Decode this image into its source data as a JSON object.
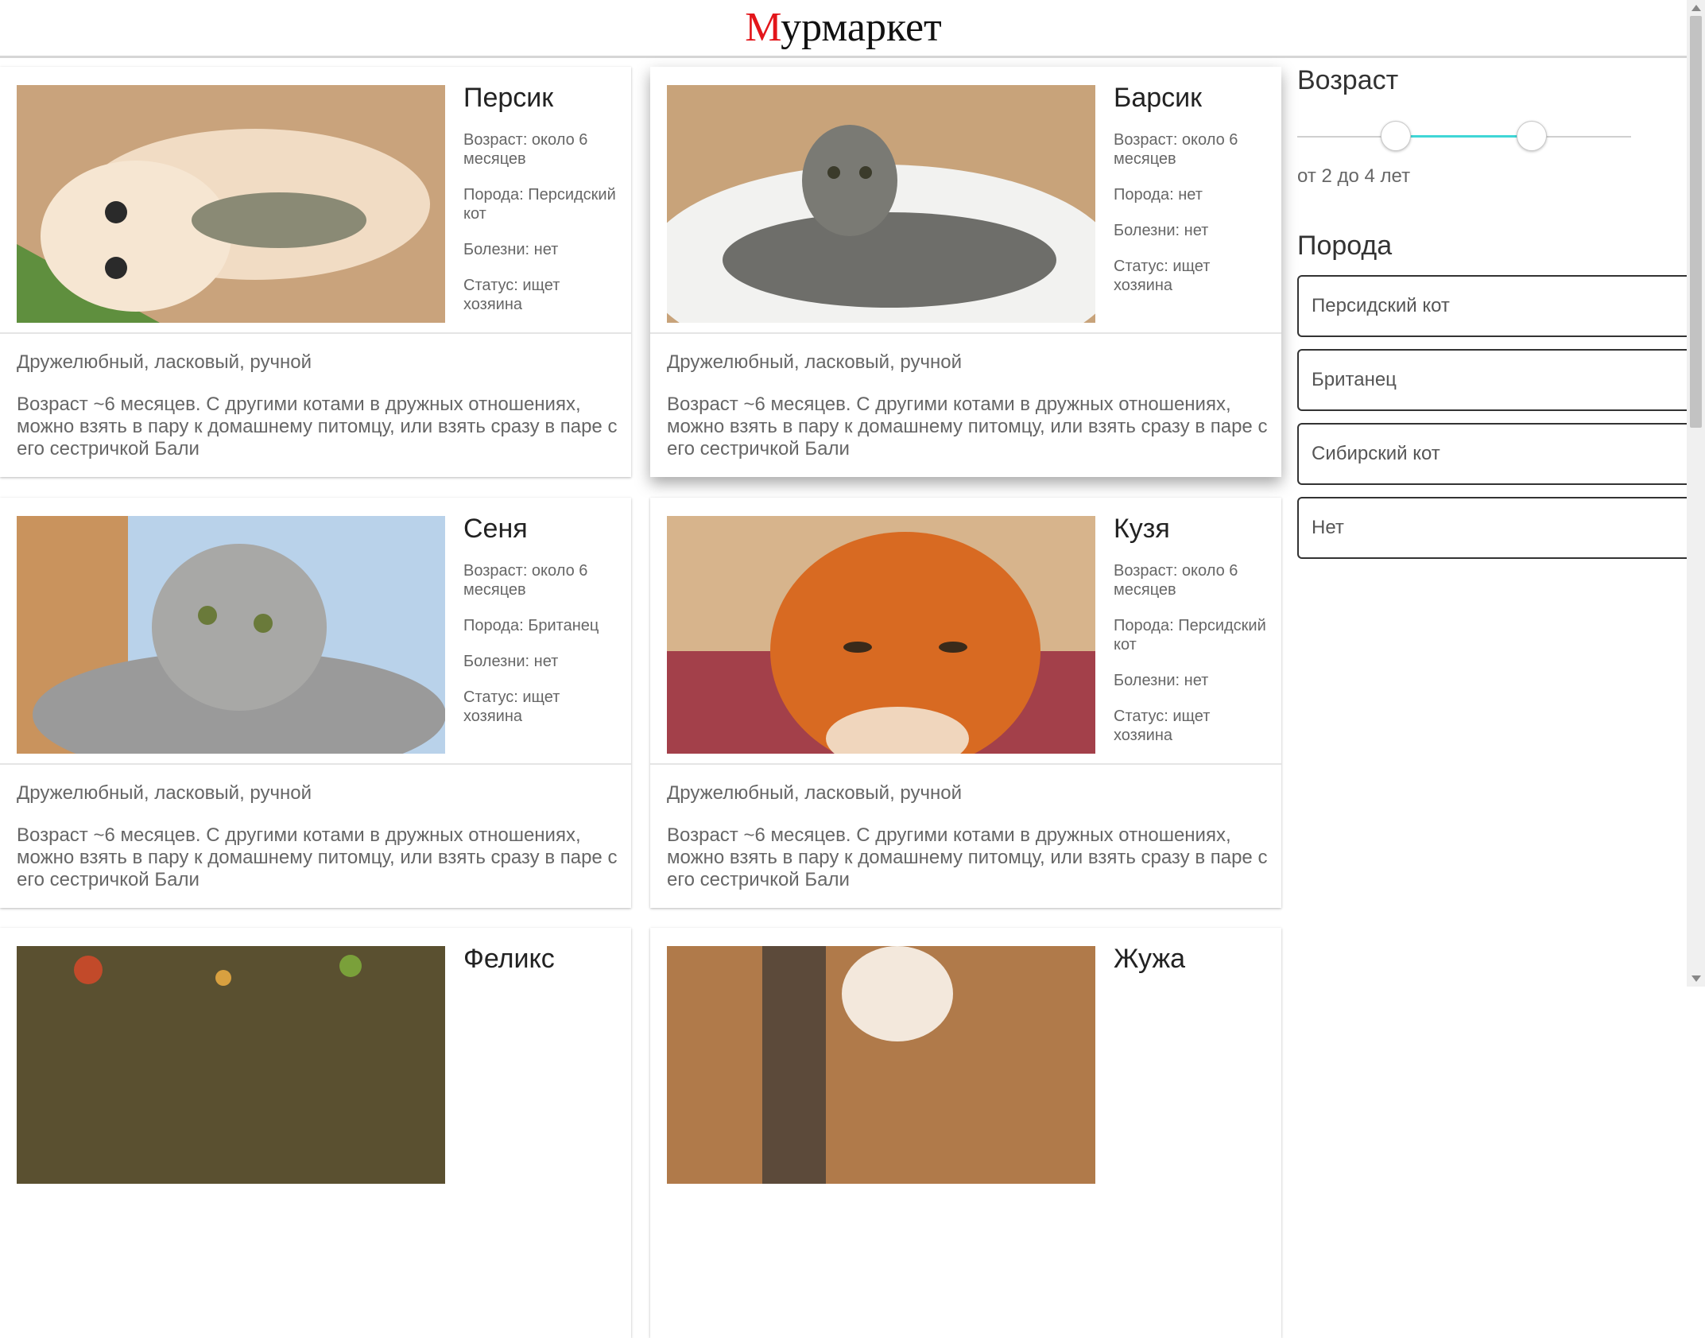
{
  "brand": {
    "first_letter": "М",
    "rest": "урмаркет"
  },
  "labels": {
    "age": "Возраст: около 6 месяцев",
    "tagline": "Дружелюбный, ласковый, ручной",
    "desc": "Возраст ~6 месяцев. С другими котами в дружных отношениях, можно взять в пару к домашнему питомцу, или взять сразу в паре с его сестричкой Бали"
  },
  "cats": [
    {
      "name": "Персик",
      "age": "Возраст: около 6 месяцев",
      "breed": "Порода: Персидский кот",
      "disease": "Болезни: нет",
      "status": "Статус: ищет хозяина",
      "tagline": "Дружелюбный, ласковый, ручной",
      "desc": "Возраст ~6 месяцев. С другими котами в дружных отношениях, можно взять в пару к домашнему питомцу, или взять сразу в паре с его сестричкой Бали"
    },
    {
      "name": "Барсик",
      "age": "Возраст: около 6 месяцев",
      "breed": "Порода: нет",
      "disease": "Болезни: нет",
      "status": "Статус: ищет хозяина",
      "tagline": "Дружелюбный, ласковый, ручной",
      "desc": "Возраст ~6 месяцев. С другими котами в дружных отношениях, можно взять в пару к домашнему питомцу, или взять сразу в паре с его сестричкой Бали"
    },
    {
      "name": "Сеня",
      "age": "Возраст: около 6 месяцев",
      "breed": "Порода: Британец",
      "disease": "Болезни: нет",
      "status": "Статус: ищет хозяина",
      "tagline": "Дружелюбный, ласковый, ручной",
      "desc": "Возраст ~6 месяцев. С другими котами в дружных отношениях, можно взять в пару к домашнему питомцу, или взять сразу в паре с его сестричкой Бали"
    },
    {
      "name": "Кузя",
      "age": "Возраст: около 6 месяцев",
      "breed": "Порода: Персидский кот",
      "disease": "Болезни: нет",
      "status": "Статус: ищет хозяина",
      "tagline": "Дружелюбный, ласковый, ручной",
      "desc": "Возраст ~6 месяцев. С другими котами в дружных отношениях, можно взять в пару к домашнему питомцу, или взять сразу в паре с его сестричкой Бали"
    },
    {
      "name": "Феликс"
    },
    {
      "name": "Жужа"
    }
  ],
  "filters": {
    "age_title": "Возраст",
    "age_range_text": "от 2 до 4 лет",
    "breed_title": "Порода",
    "breeds": [
      "Персидский кот",
      "Британец",
      "Сибирский кот",
      "Нет"
    ]
  },
  "colors": {
    "accent": "#3fd6d6",
    "brand_red": "#e3161b"
  }
}
